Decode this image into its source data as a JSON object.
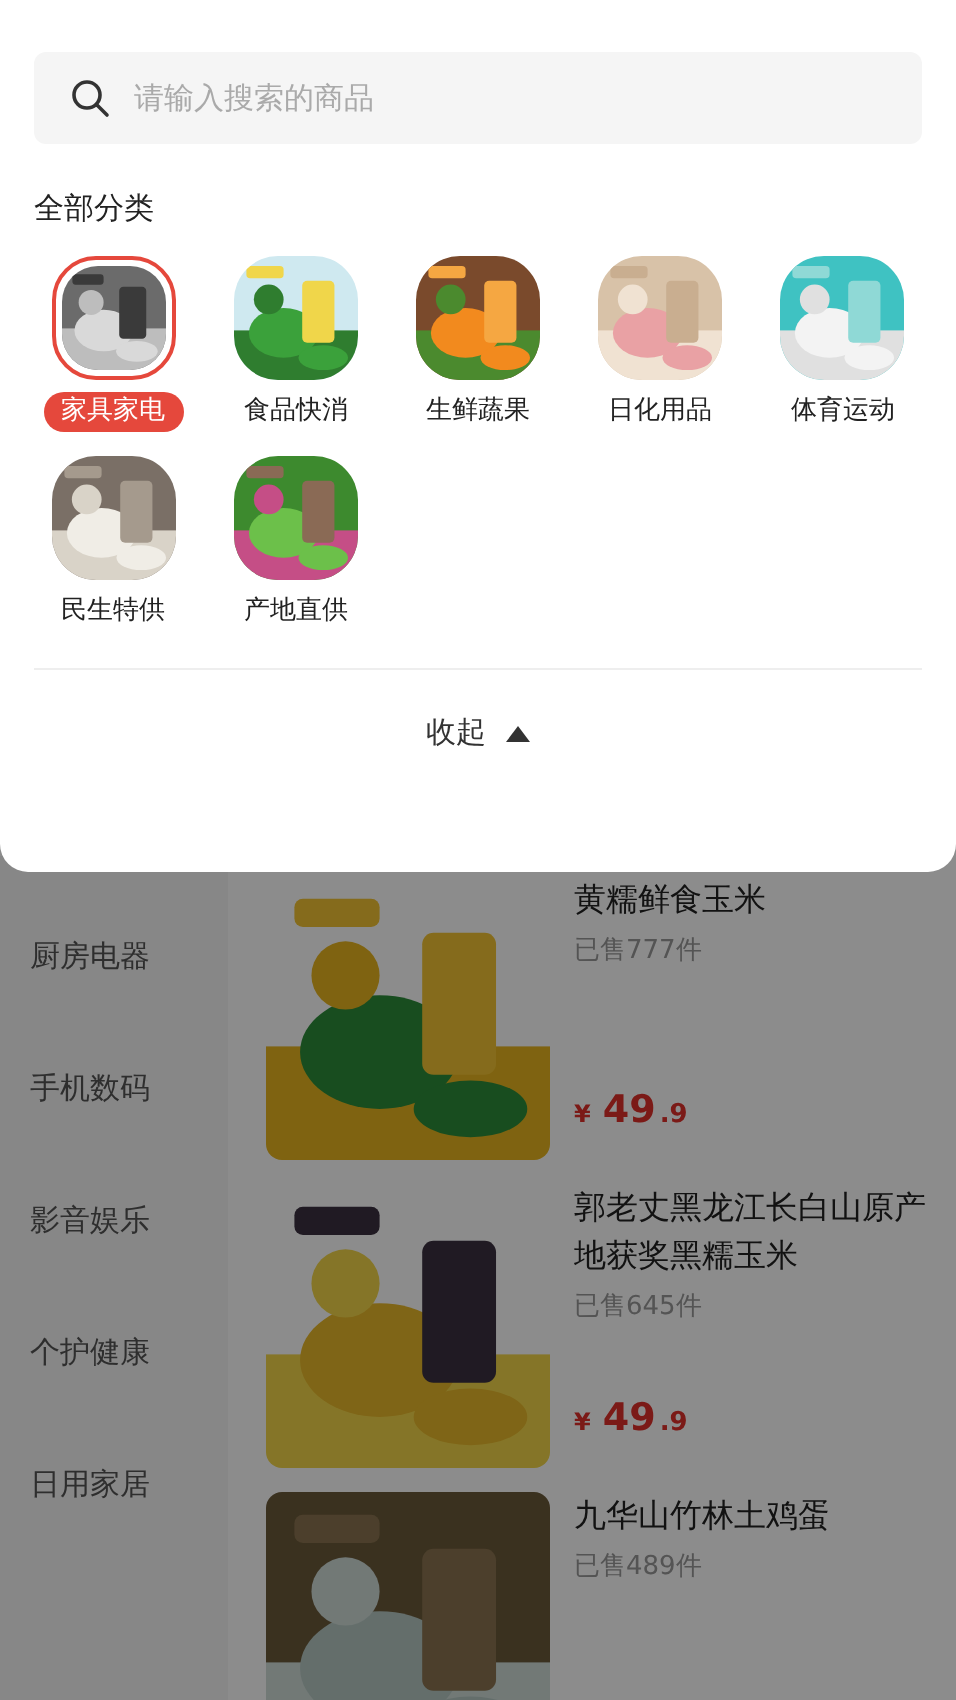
{
  "search": {
    "placeholder": "请输入搜索的商品"
  },
  "panel": {
    "title": "全部分类",
    "collapse": "收起",
    "categories": [
      {
        "label": "家具家电",
        "selected": true,
        "kind": "picture"
      },
      {
        "label": "食品快消",
        "selected": false,
        "kind": "picture"
      },
      {
        "label": "生鲜蔬果",
        "selected": false,
        "kind": "picture"
      },
      {
        "label": "日化用品",
        "selected": false,
        "kind": "picture"
      },
      {
        "label": "体育运动",
        "selected": false,
        "kind": "picture"
      },
      {
        "label": "民生特供",
        "selected": false,
        "kind": "picture"
      },
      {
        "label": "产地直供",
        "selected": false,
        "kind": "picture"
      }
    ]
  },
  "sidebar": {
    "items": [
      "厨房电器",
      "手机数码",
      "影音娱乐",
      "个护健康",
      "日用家居"
    ]
  },
  "products": [
    {
      "title": "黄糯鲜食玉米",
      "sold": "已售777件",
      "currency": "¥",
      "price_int": "49",
      "price_dec": ".9",
      "kind": "picture"
    },
    {
      "title": "郭老丈黑龙江长白山原产地获奖黑糯玉米",
      "sold": "已售645件",
      "currency": "¥",
      "price_int": "49",
      "price_dec": ".9",
      "kind": "picture"
    },
    {
      "title": "九华山竹林土鸡蛋",
      "sold": "已售489件",
      "kind": "picture"
    }
  ]
}
